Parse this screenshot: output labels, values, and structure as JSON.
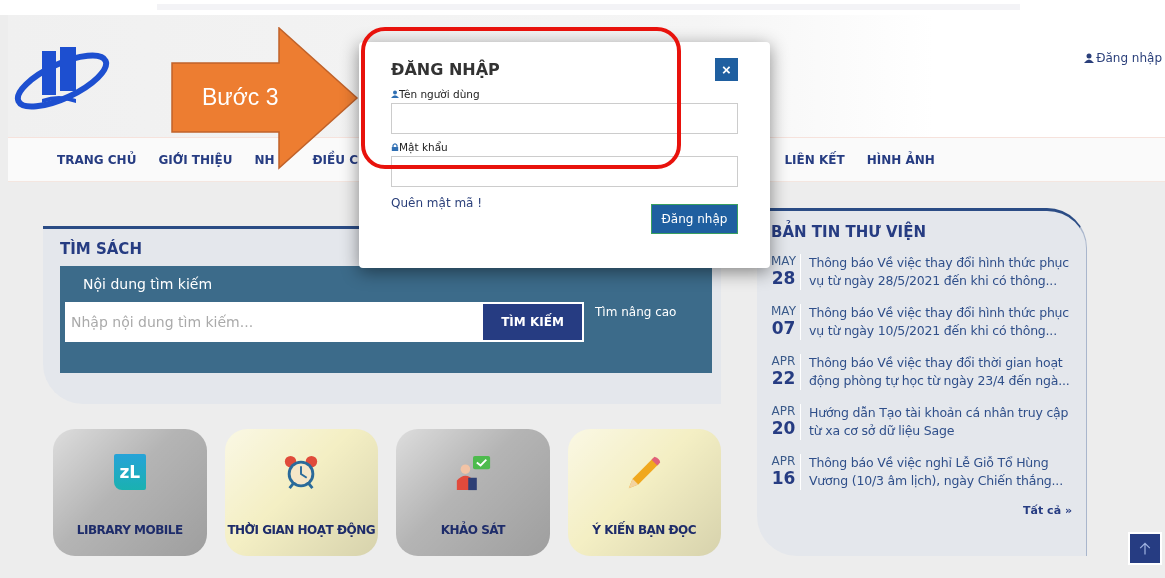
{
  "header": {
    "login_link": "Đăng nhập"
  },
  "nav": [
    {
      "label": "TRANG CHỦ"
    },
    {
      "label": "GIỚI THIỆU"
    },
    {
      "parts": [
        "NH",
        "ĐIỀU C"
      ]
    },
    {
      "label": "LIÊN KẾT"
    },
    {
      "label": "HÌNH ẢNH"
    }
  ],
  "search": {
    "title": "TÌM SÁCH",
    "label": "Nội dung tìm kiếm",
    "placeholder": "Nhập nội dung tìm kiếm...",
    "button": "TÌM KIẾM",
    "advanced_link": "Tìm nâng cao"
  },
  "tiles": [
    {
      "label": "LIBRARY MOBILE",
      "kind": "book",
      "color": "#b4b4b4",
      "icon_text": "zL"
    },
    {
      "label": "THỜI GIAN HOẠT ĐỘNG",
      "kind": "clock",
      "color": "#f4efc4"
    },
    {
      "label": "KHẢO SÁT",
      "kind": "survey",
      "color": "#b4b4b4"
    },
    {
      "label": "Ý KIẾN BẠN ĐỌC",
      "kind": "pencil",
      "color": "#f4efc4"
    }
  ],
  "news": {
    "title": "BẢN TIN THƯ VIỆN",
    "items": [
      {
        "month": "MAY",
        "day": "28",
        "text": "Thông báo Về việc thay đổi hình thức phục vụ từ ngày 28/5/2021 đến khi có thông..."
      },
      {
        "month": "MAY",
        "day": "07",
        "text": "Thông báo Về việc thay đổi hình thức phục vụ từ ngày 10/5/2021 đến khi có thông..."
      },
      {
        "month": "APR",
        "day": "22",
        "text": "Thông báo Về việc thay đổi thời gian hoạt động phòng tự học từ ngày 23/4 đến ngà..."
      },
      {
        "month": "APR",
        "day": "20",
        "text": "Hướng dẫn Tạo tài khoản cá nhân truy cập từ xa cơ sở dữ liệu Sage"
      },
      {
        "month": "APR",
        "day": "16",
        "text": "Thông báo Về việc nghỉ Lễ Giỗ Tổ Hùng Vương (10/3 âm lịch), ngày Chiến thắng..."
      }
    ],
    "all_link": "Tất cả »"
  },
  "callout": {
    "text": "Bước 3"
  },
  "login_dialog": {
    "title": "ĐĂNG NHẬP",
    "close": "×",
    "username_label": "Tên người dùng",
    "password_label": "Mật khẩu",
    "forgot_link": "Quên mật mã !",
    "submit": "Đăng nhập"
  }
}
